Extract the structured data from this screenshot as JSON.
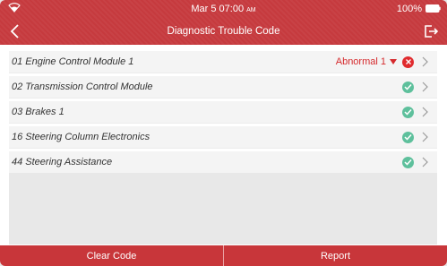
{
  "status_bar": {
    "date": "Mar 5",
    "time": "07:00",
    "ampm": "AM",
    "battery": "100%"
  },
  "header": {
    "title": "Diagnostic Trouble Code"
  },
  "modules": [
    {
      "label": "01 Engine Control Module 1",
      "status": "abnormal",
      "status_text": "Abnormal 1"
    },
    {
      "label": "02 Transmission Control Module",
      "status": "ok",
      "status_text": ""
    },
    {
      "label": "03 Brakes 1",
      "status": "ok",
      "status_text": ""
    },
    {
      "label": "16 Steering Column Electronics",
      "status": "ok",
      "status_text": ""
    },
    {
      "label": "44 Steering Assistance",
      "status": "ok",
      "status_text": ""
    }
  ],
  "actions": {
    "clear_code": "Clear Code",
    "report": "Report"
  },
  "colors": {
    "header_red": "#c63a3e",
    "ok_green": "#5ec09c",
    "error_red": "#e02b2e"
  },
  "icons": {
    "wifi": "wifi-icon",
    "battery": "battery-icon",
    "back": "back-arrow-icon",
    "exit": "exit-icon",
    "ok": "check-circle-icon",
    "error": "x-circle-icon",
    "chevron": "chevron-right-icon"
  }
}
